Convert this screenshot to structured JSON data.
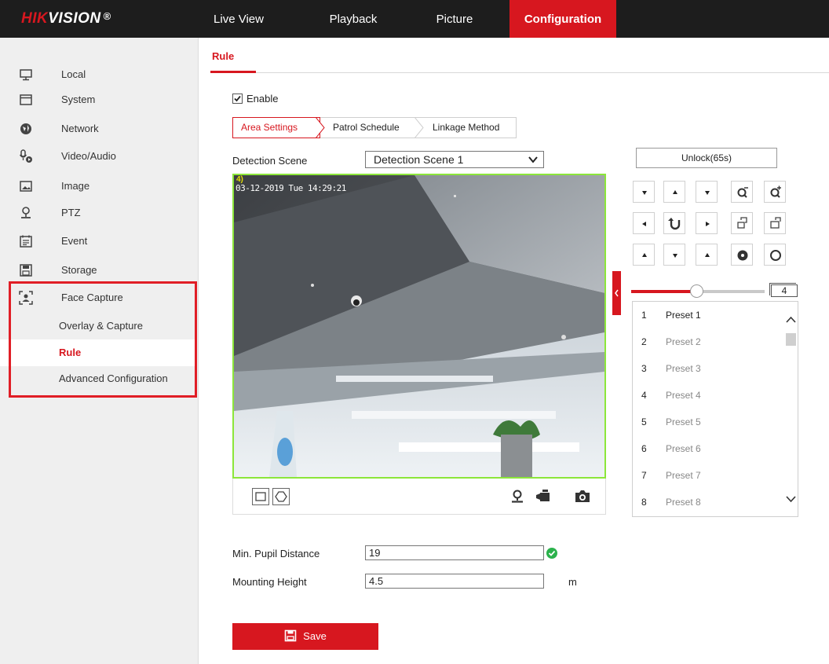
{
  "brand": {
    "logo_red": "HIK",
    "logo_white": "VISION",
    "logo_reg": "®"
  },
  "nav": {
    "items": [
      "Live View",
      "Playback",
      "Picture",
      "Configuration"
    ],
    "active": "Configuration"
  },
  "sidebar": {
    "items": [
      {
        "label": "Local",
        "icon": "monitor-icon"
      },
      {
        "label": "System",
        "icon": "system-window-icon"
      },
      {
        "label": "Network",
        "icon": "network-globe-icon"
      },
      {
        "label": "Video/Audio",
        "icon": "microphone-camera-icon"
      },
      {
        "label": "Image",
        "icon": "image-icon"
      },
      {
        "label": "PTZ",
        "icon": "ptz-icon"
      },
      {
        "label": "Event",
        "icon": "event-calendar-icon"
      },
      {
        "label": "Storage",
        "icon": "storage-disk-icon"
      },
      {
        "label": "Face Capture",
        "icon": "face-capture-icon"
      }
    ],
    "subitems": [
      "Overlay & Capture",
      "Rule",
      "Advanced Configuration"
    ],
    "active_sub": "Rule"
  },
  "page": {
    "tab": "Rule"
  },
  "enable": {
    "label": "Enable",
    "checked": true
  },
  "subtabs": [
    "Area Settings",
    "Patrol Schedule",
    "Linkage Method"
  ],
  "detection": {
    "label": "Detection Scene",
    "value": "Detection Scene 1"
  },
  "video": {
    "timestamp": "03-12-2019 Tue 14:29:21",
    "osd_mark": "4)"
  },
  "ptz": {
    "unlock_label": "Unlock(65s)",
    "speed": "4",
    "speed_fraction": 0.47,
    "presets": [
      {
        "num": "1",
        "name": "Preset 1"
      },
      {
        "num": "2",
        "name": "Preset 2"
      },
      {
        "num": "3",
        "name": "Preset 3"
      },
      {
        "num": "4",
        "name": "Preset 4"
      },
      {
        "num": "5",
        "name": "Preset 5"
      },
      {
        "num": "6",
        "name": "Preset 6"
      },
      {
        "num": "7",
        "name": "Preset 7"
      },
      {
        "num": "8",
        "name": "Preset 8"
      }
    ]
  },
  "fields": {
    "pupil": {
      "label": "Min. Pupil Distance",
      "value": "19"
    },
    "mount": {
      "label": "Mounting Height",
      "value": "4.5",
      "unit": "m"
    }
  },
  "save_label": "Save",
  "colors": {
    "accent": "#d7171f",
    "topbar": "#1d1d1d",
    "video_border": "#8ce63a",
    "ok": "#2bb24c"
  }
}
